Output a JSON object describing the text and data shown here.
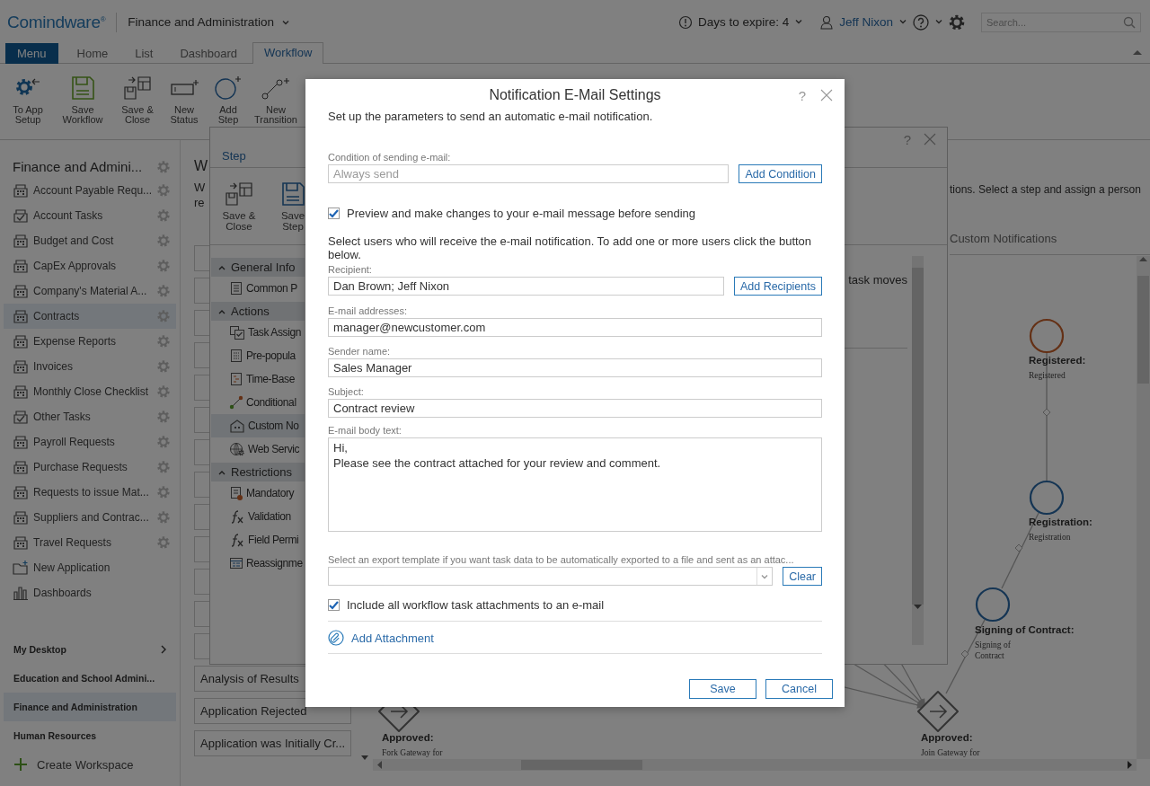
{
  "header": {
    "logo": "Comindware$^{®}$",
    "workspace": "Finance and Administration",
    "days_to_expire": "Days to expire: 4",
    "user": "Jeff Nixon",
    "search": {
      "placeholder": "Search..."
    }
  },
  "tabs": [
    {
      "label": "Menu",
      "kind": "menu",
      "selected": false
    },
    {
      "label": "Home",
      "kind": "tab",
      "selected": false
    },
    {
      "label": "List",
      "kind": "tab",
      "selected": false
    },
    {
      "label": "Dashboard",
      "kind": "tab",
      "selected": false
    },
    {
      "label": "Workflow",
      "kind": "tab",
      "selected": true
    }
  ],
  "ribbon": [
    {
      "label": "To App Setup",
      "kind": "app-setup"
    },
    {
      "label": "Save Workflow",
      "kind": "save"
    },
    {
      "label": "Save & Close",
      "kind": "save-close"
    },
    {
      "label": "New Status",
      "kind": "status"
    },
    {
      "label": "Add Step",
      "kind": "step"
    },
    {
      "label": "New Transition",
      "kind": "transition"
    }
  ],
  "sidebar": {
    "title": "Finance and Admini...",
    "items": [
      {
        "label": "Account Payable Requ...",
        "kind": "app",
        "selected": false
      },
      {
        "label": "Account Tasks",
        "kind": "tasks",
        "selected": false
      },
      {
        "label": "Budget and Cost",
        "kind": "app",
        "selected": false
      },
      {
        "label": "CapEx Approvals",
        "kind": "app",
        "selected": false
      },
      {
        "label": "Company's Material A...",
        "kind": "app",
        "selected": false
      },
      {
        "label": "Contracts",
        "kind": "app",
        "selected": true
      },
      {
        "label": "Expense Reports",
        "kind": "app",
        "selected": false
      },
      {
        "label": "Invoices",
        "kind": "app",
        "selected": false
      },
      {
        "label": "Monthly Close Checklist",
        "kind": "app",
        "selected": false
      },
      {
        "label": "Other Tasks",
        "kind": "tasks",
        "selected": false
      },
      {
        "label": "Payroll Requests",
        "kind": "app",
        "selected": false
      },
      {
        "label": "Purchase Requests",
        "kind": "app",
        "selected": false
      },
      {
        "label": "Requests to issue Mat...",
        "kind": "app",
        "selected": false
      },
      {
        "label": "Suppliers and Contrac...",
        "kind": "app",
        "selected": false
      },
      {
        "label": "Travel Requests",
        "kind": "app",
        "selected": false
      },
      {
        "label": "New Application",
        "kind": "new",
        "selected": false
      },
      {
        "label": "Dashboards",
        "kind": "dashboards",
        "selected": false
      }
    ],
    "workspaces": [
      {
        "label": "My Desktop",
        "kind": "expandable",
        "selected": false
      },
      {
        "label": "Education and School Admini...",
        "kind": "plain",
        "selected": false
      },
      {
        "label": "Finance and Administration",
        "kind": "plain",
        "selected": true
      },
      {
        "label": "Human Resources",
        "kind": "plain",
        "selected": false
      }
    ],
    "create_workspace": "Create Workspace"
  },
  "main": {
    "heading": "W",
    "description": [
      "W",
      "re"
    ],
    "list": [
      "Analysis of Results",
      "Application Rejected",
      "Application was Initially Cr..."
    ],
    "description_right": "tions. Select a step and assign a person",
    "diagram_tab": "Custom Notifications",
    "diagram": {
      "nodes": [
        {
          "kind": "status",
          "label": "Registered:",
          "caption": "Registered"
        },
        {
          "kind": "step",
          "label": "Registration:",
          "caption": "Registration"
        },
        {
          "kind": "step",
          "label": "Signing of Contract:",
          "caption": "Signing of Contract"
        },
        {
          "kind": "gateway",
          "label": "Approved:",
          "caption": "Fork Gateway for"
        },
        {
          "kind": "gateway",
          "label": "Approved:",
          "caption": "Join Gateway for"
        }
      ]
    }
  },
  "step_panel": {
    "help": "?",
    "tab": "Step",
    "toolbar": [
      {
        "label": "Save & Close",
        "kind": "save-close"
      },
      {
        "label": "Save Step",
        "kind": "save"
      }
    ],
    "tree": [
      {
        "label": "General Info",
        "expanded": true,
        "children": [
          {
            "label": "Common P",
            "kind": "form",
            "selected": false
          }
        ]
      },
      {
        "label": "Actions",
        "expanded": true,
        "children": [
          {
            "label": "Task Assign",
            "kind": "task",
            "selected": false
          },
          {
            "label": "Pre-popula",
            "kind": "prefill",
            "selected": false
          },
          {
            "label": "Time-Base",
            "kind": "timer",
            "selected": false
          },
          {
            "label": "Conditional",
            "kind": "conditional",
            "selected": false
          },
          {
            "label": "Custom No",
            "kind": "notification",
            "selected": true
          },
          {
            "label": "Web Servic",
            "kind": "web",
            "selected": false
          }
        ]
      },
      {
        "label": "Restrictions",
        "expanded": true,
        "children": [
          {
            "label": "Mandatory",
            "kind": "mandatory",
            "selected": false
          },
          {
            "label": "Validation",
            "kind": "formula",
            "selected": false
          },
          {
            "label": "Field Permi",
            "kind": "formula",
            "selected": false
          },
          {
            "label": "Reassignme",
            "kind": "reassign",
            "selected": false
          }
        ]
      }
    ],
    "detail_fragment": "task moves"
  },
  "dialog": {
    "title": "Notification E-Mail Settings",
    "help": "?",
    "subtitle": "Set up the parameters to send an automatic e-mail notification.",
    "condition": {
      "label": "Condition of sending e-mail:",
      "placeholder": "Always send",
      "button": "Add Condition"
    },
    "preview": {
      "label": "Preview and make changes to your e-mail message before sending",
      "checked": true
    },
    "recipients_hint": "Select users who will receive the e-mail notification. To add one or more users click the button below.",
    "recipient": {
      "label": "Recipient:",
      "value": "Dan Brown; Jeff Nixon",
      "button": "Add Recipients"
    },
    "email": {
      "label": "E-mail addresses:",
      "value": "manager@newcustomer.com"
    },
    "sender": {
      "label": "Sender name:",
      "value": "Sales Manager"
    },
    "subject": {
      "label": "Subject:",
      "value": "Contract review"
    },
    "body": {
      "label": "E-mail body text:",
      "value": "Hi,\nPlease see the contract attached for your review and comment."
    },
    "export": {
      "label": "Select an export template if you want task data to be automatically exported to a file and sent as an attac...",
      "button": "Clear"
    },
    "attachments": {
      "label": "Include all workflow task attachments to an e-mail",
      "checked": true
    },
    "add_attachment": "Add Attachment",
    "buttons": [
      "Save",
      "Cancel"
    ]
  }
}
